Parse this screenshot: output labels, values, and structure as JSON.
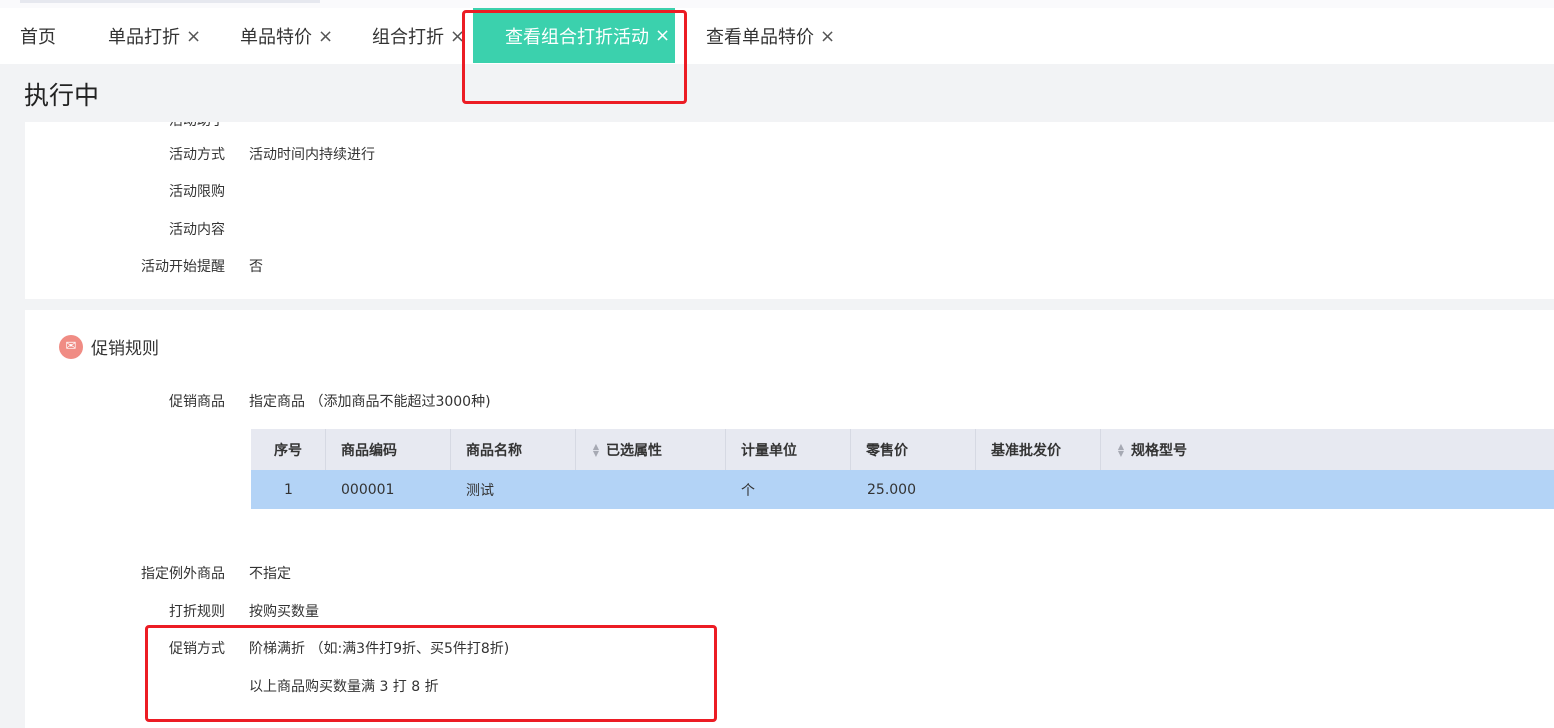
{
  "tabs": [
    {
      "label": "首页",
      "closable": false
    },
    {
      "label": "单品打折",
      "closable": true
    },
    {
      "label": "单品特价",
      "closable": true
    },
    {
      "label": "组合打折",
      "closable": true
    },
    {
      "label": "查看组合打折活动",
      "closable": true,
      "active": true
    },
    {
      "label": "查看单品特价",
      "closable": true
    }
  ],
  "close_glyph": "×",
  "status": "执行中",
  "basic_info": {
    "cut_off_label": "活动助手",
    "rows": [
      {
        "label": "活动方式",
        "value": "活动时间内持续进行"
      },
      {
        "label": "活动限购",
        "value": ""
      },
      {
        "label": "活动内容",
        "value": ""
      },
      {
        "label": "活动开始提醒",
        "value": "否"
      }
    ]
  },
  "promo_rules": {
    "title": "促销规则",
    "icon": "ticket-icon",
    "icon_glyph": "✉",
    "goods_label": "促销商品",
    "goods_value": "指定商品 （添加商品不能超过3000种)",
    "table": {
      "headers": [
        "序号",
        "商品编码",
        "商品名称",
        "已选属性",
        "计量单位",
        "零售价",
        "基准批发价",
        "规格型号"
      ],
      "rows": [
        [
          "1",
          "000001",
          "测试",
          "",
          "个",
          "25.000",
          "",
          ""
        ]
      ]
    },
    "exception_label": "指定例外商品",
    "exception_value": "不指定",
    "discount_rule_label": "打折规则",
    "discount_rule_value": "按购买数量",
    "method_label": "促销方式",
    "method_value": "阶梯满折 （如:满3件打9折、买5件打8折)",
    "method_detail": "以上商品购买数量满 3 打 8 折"
  },
  "colors": {
    "active_tab": "#3bd1ad",
    "highlight": "#ec1c24",
    "table_header": "#e7e9f1",
    "table_row_selected": "#b3d3f6"
  }
}
